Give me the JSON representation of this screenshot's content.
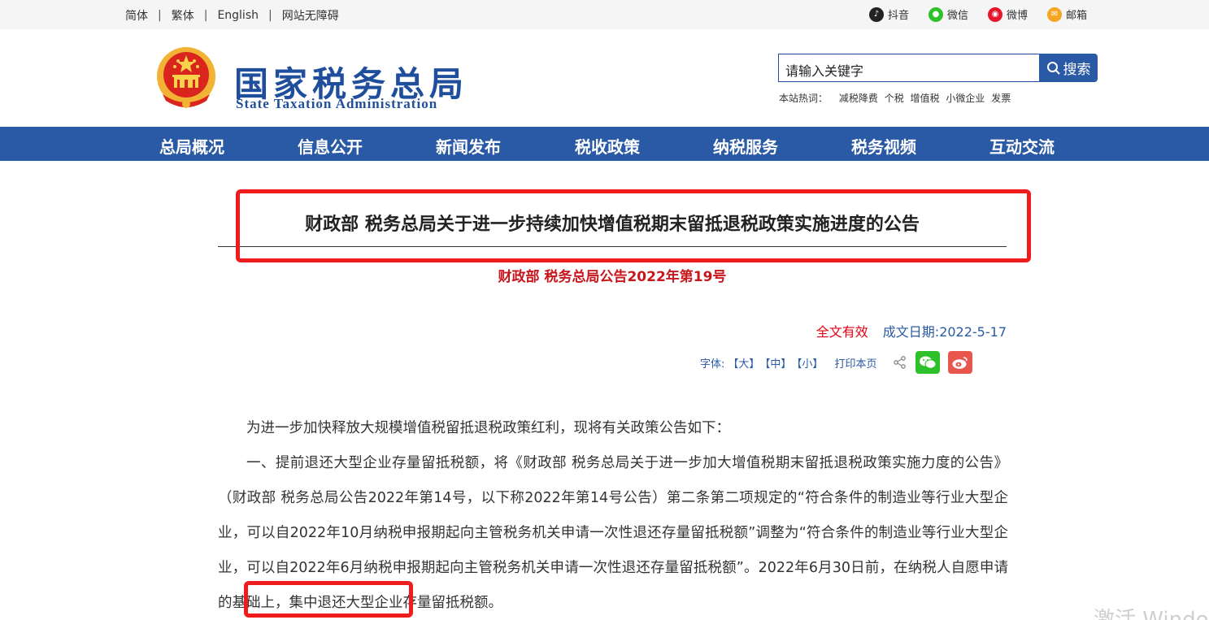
{
  "topbar": {
    "langs": [
      "简体",
      "繁体",
      "English",
      "网站无障碍"
    ],
    "social": [
      {
        "label": "抖音",
        "icon": "douyin-icon",
        "color": "#222222"
      },
      {
        "label": "微信",
        "icon": "wechat-icon",
        "color": "#2ec12a"
      },
      {
        "label": "微博",
        "icon": "weibo-icon",
        "color": "#e6162d"
      },
      {
        "label": "邮箱",
        "icon": "mail-icon",
        "color": "#f5a623"
      }
    ]
  },
  "header": {
    "logo_cn": "国家税务总局",
    "logo_en": "State Taxation Administration",
    "search_value": "请输入关键字",
    "search_button": "搜索",
    "hot_label": "本站热词：",
    "hot_words": [
      "减税降费",
      "个税",
      "增值税",
      "小微企业",
      "发票"
    ]
  },
  "nav": [
    "总局概况",
    "信息公开",
    "新闻发布",
    "税收政策",
    "纳税服务",
    "税务视频",
    "互动交流"
  ],
  "article": {
    "title": "财政部  税务总局关于进一步持续加快增值税期末留抵退税政策实施进度的公告",
    "doc_no": "财政部 税务总局公告2022年第19号",
    "status": "全文有效",
    "date_label": "成文日期:2022-5-17",
    "font_label": "字体:",
    "font_large": "【大】",
    "font_medium": "【中】",
    "font_small": "【小】",
    "print": "打印本页",
    "para1": "为进一步加快释放大规模增值税留抵退税政策红利，现将有关政策公告如下：",
    "para2": "一、提前退还大型企业存量留抵税额，将《财政部  税务总局关于进一步加大增值税期末留抵退税政策实施力度的公告》（财政部  税务总局公告2022年第14号，以下称2022年第14号公告）第二条第二项规定的“符合条件的制造业等行业大型企业，可以自2022年10月纳税申报期起向主管税务机关申请一次性退还存量留抵税额”调整为“符合条件的制造业等行业大型企业，可以自2022年6月纳税申报期起向主管税务机关申请一次性退还存量留抵税额”。2022年6月30日前，在纳税人自愿申请的基础上，集中退还大型企业存量留抵税额。"
  },
  "watermark": "激活 Windows",
  "colors": {
    "brand": "#2a5aa5",
    "highlight": "#ee1c1c",
    "doc_no": "#c8161d"
  }
}
